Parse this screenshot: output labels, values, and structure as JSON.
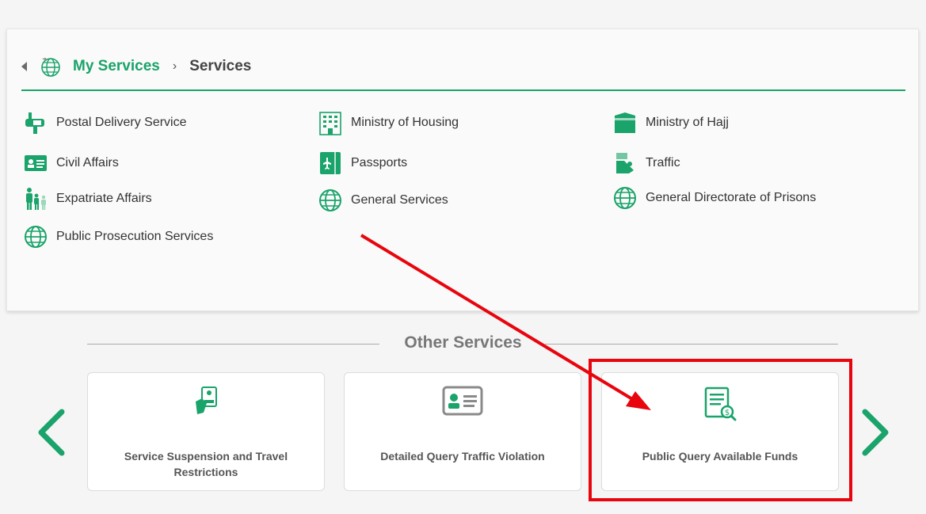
{
  "breadcrumb": {
    "home": "My Services",
    "separator": "›",
    "current": "Services"
  },
  "services": [
    {
      "label": "Postal Delivery Service",
      "icon": "mailbox-icon"
    },
    {
      "label": "Ministry of Housing",
      "icon": "building-icon"
    },
    {
      "label": "Ministry of Hajj",
      "icon": "kaaba-icon"
    },
    {
      "label": "Civil Affairs",
      "icon": "id-card-icon"
    },
    {
      "label": "Passports",
      "icon": "passport-icon"
    },
    {
      "label": "Traffic",
      "icon": "traffic-icon"
    },
    {
      "label": "Expatriate Affairs",
      "icon": "family-icon"
    },
    {
      "label": "General Services",
      "icon": "globe-icon"
    },
    {
      "label": "General Directorate of Prisons",
      "icon": "globe-icon"
    },
    {
      "label": "Public Prosecution Services",
      "icon": "globe-icon"
    }
  ],
  "other_services": {
    "title": "Other Services",
    "cards": [
      {
        "label": "Service Suspension and Travel Restrictions",
        "icon": "passport-hand-icon"
      },
      {
        "label": "Detailed Query Traffic Violation",
        "icon": "id-card-icon"
      },
      {
        "label": "Public Query Available Funds",
        "icon": "document-money-icon"
      }
    ]
  },
  "colors": {
    "accent": "#1aa36a",
    "highlight": "#e8050d"
  }
}
